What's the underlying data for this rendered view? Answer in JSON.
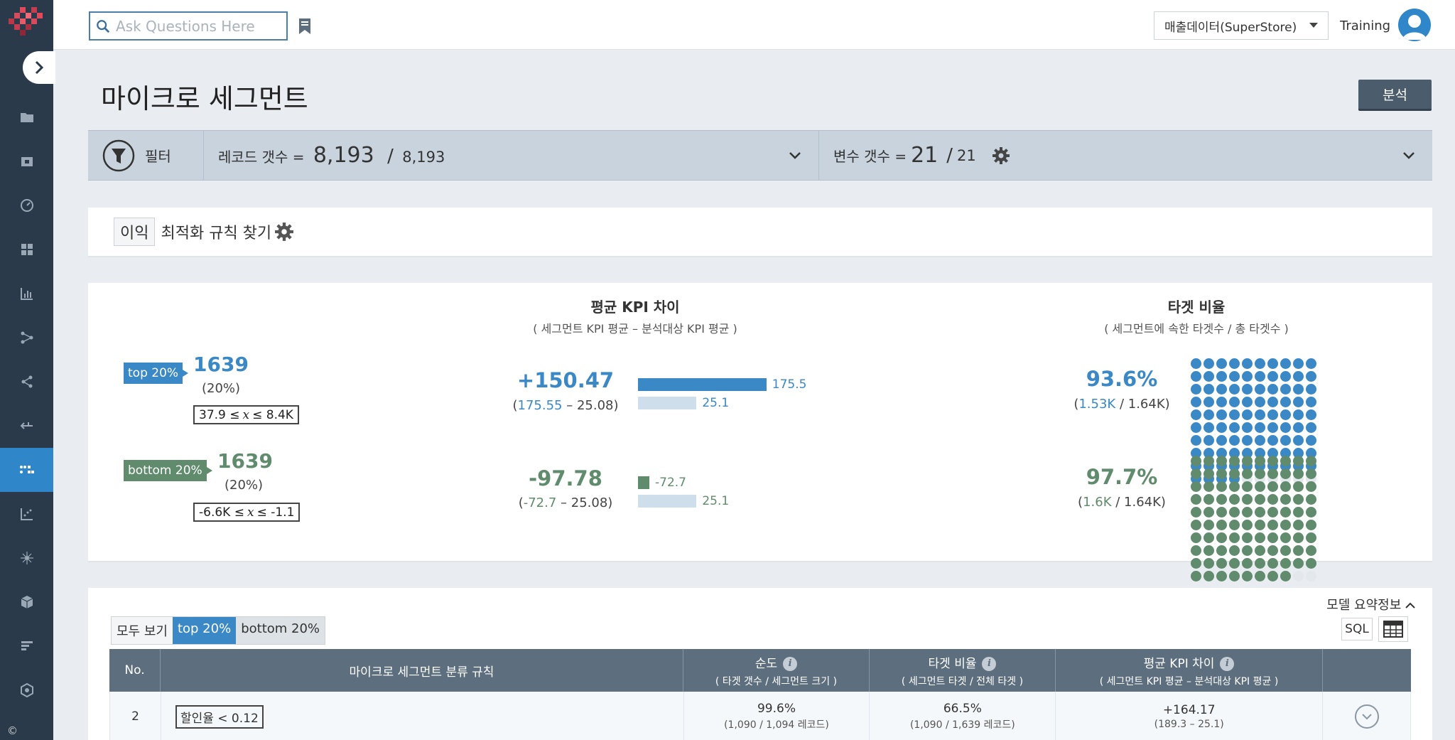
{
  "header": {
    "search_placeholder": "Ask Questions Here",
    "datasource": "매출데이터(SuperStore)",
    "user": "Training"
  },
  "page": {
    "title": "마이크로 세그먼트",
    "analyze_label": "분석"
  },
  "filter": {
    "label": "필터",
    "records_label": "레코드 갯수 =",
    "records_current": "8,193",
    "records_sep": "/",
    "records_total": "8,193",
    "vars_label": "변수 갯수 =",
    "vars_current": "21",
    "vars_sep": "/",
    "vars_total": "21"
  },
  "rule": {
    "tag": "이익",
    "text": "최적화 규칙 찾기"
  },
  "summary": {
    "kpi_title": "평균 KPI 차이",
    "kpi_subtitle": "( 세그먼트 KPI 평균 – 분석대상 KPI 평균 )",
    "target_title": "타겟 비율",
    "target_subtitle": "( 세그먼트에 속한 타겟수 / 총 타겟수 )",
    "top": {
      "tag": "top 20%",
      "count": "1639",
      "pct": "(20%)",
      "range_low": "37.9",
      "range_op": "≤",
      "range_var": "x",
      "range_high": "8.4K",
      "kpi": "+150.47",
      "kpi_paren_open": "(",
      "kpi_seg": "175.55",
      "kpi_dash": " – ",
      "kpi_base": "25.08",
      "kpi_paren_close": ")",
      "bar_seg": 175.5,
      "bar_seg_label": "175.5",
      "bar_base": 25.1,
      "bar_base_label": "25.1",
      "target": "93.6%",
      "target_fraction": 0.936,
      "target_num": "1.53K",
      "target_sep": " / ",
      "target_den": "1.64K"
    },
    "bottom": {
      "tag": "bottom 20%",
      "count": "1639",
      "pct": "(20%)",
      "range_low": "-6.6K",
      "range_op": "≤",
      "range_var": "x",
      "range_high": "-1.1",
      "kpi": "-97.78",
      "kpi_paren_open": "(",
      "kpi_seg": "-72.7",
      "kpi_dash": " – ",
      "kpi_base": "25.08",
      "kpi_paren_close": ")",
      "bar_seg": -72.7,
      "bar_seg_label": "-72.7",
      "bar_base": 25.1,
      "bar_base_label": "25.1",
      "target": "97.7%",
      "target_fraction": 0.977,
      "target_num": "1.6K",
      "target_sep": " / ",
      "target_den": "1.64K"
    }
  },
  "table": {
    "model_info": "모델 요약정보",
    "tabs": [
      "모두 보기",
      "top 20%",
      "bottom 20%"
    ],
    "sql_label": "SQL",
    "columns": {
      "no": "No.",
      "rule": "마이크로 세그먼트 분류 규칙",
      "purity": "순도",
      "purity_sub": "( 타겟 갯수 / 세그먼트 크기 )",
      "target": "타겟 비율",
      "target_sub": "( 세그먼트 타겟 / 전체 타겟 )",
      "kpi": "평균 KPI 차이",
      "kpi_sub": "( 세그먼트 KPI 평균 – 분석대상 KPI 평균 )"
    },
    "rows": [
      {
        "no": "2",
        "rule": "할인율 < 0.12",
        "purity": "99.6%",
        "purity_sub": "(1,090 / 1,094 레코드)",
        "target": "66.5%",
        "target_sub": "(1,090 / 1,639 레코드)",
        "kpi": "+164.17",
        "kpi_sub": "(189.3 – 25.1)"
      }
    ]
  },
  "sidebar": {
    "copyright": "©"
  },
  "colors": {
    "blue": "#3a88c6",
    "green": "#608b6d",
    "light": "#cfdeeb",
    "sidebar": "#2a3a4a"
  }
}
